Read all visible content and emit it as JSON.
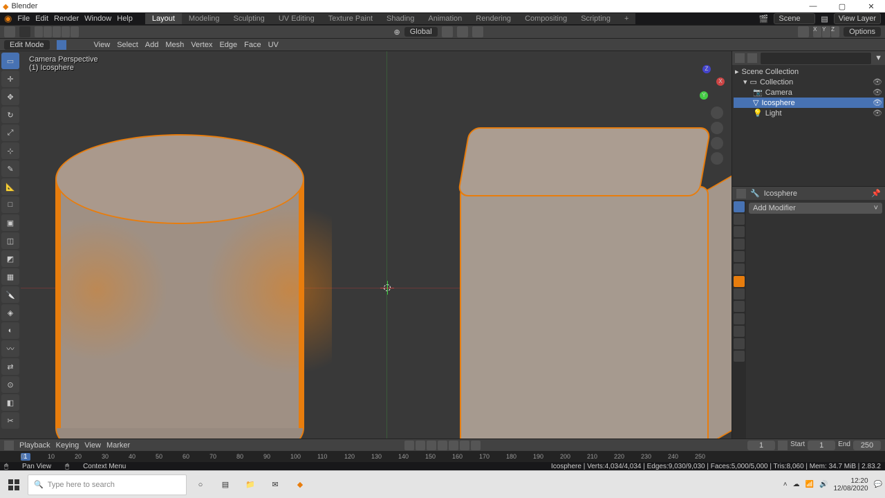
{
  "app": {
    "title": "Blender"
  },
  "window_controls": {
    "min": "—",
    "max": "▢",
    "close": "✕"
  },
  "menus": [
    "File",
    "Edit",
    "Render",
    "Window",
    "Help"
  ],
  "workspaces": [
    "Layout",
    "Modeling",
    "Sculpting",
    "UV Editing",
    "Texture Paint",
    "Shading",
    "Animation",
    "Rendering",
    "Compositing",
    "Scripting"
  ],
  "workspace_active": 0,
  "scene": {
    "label": "Scene",
    "layer": "View Layer"
  },
  "transform_orientation": "Global",
  "options_label": "Options",
  "mode": "Edit Mode",
  "mode_menus": [
    "View",
    "Select",
    "Add",
    "Mesh",
    "Vertex",
    "Edge",
    "Face",
    "UV"
  ],
  "viewport": {
    "persp": "Camera Perspective",
    "obj": "(1) Icosphere"
  },
  "outliner": {
    "root": "Scene Collection",
    "collection": "Collection",
    "items": [
      {
        "name": "Camera",
        "icon": "📷"
      },
      {
        "name": "Icosphere",
        "icon": "▽",
        "selected": true
      },
      {
        "name": "Light",
        "icon": "💡"
      }
    ]
  },
  "properties": {
    "context": "Icosphere",
    "add_modifier": "Add Modifier"
  },
  "timeline": {
    "playback": "Playback",
    "keying": "Keying",
    "view": "View",
    "marker": "Marker",
    "current": "1",
    "start_label": "Start",
    "start": "1",
    "end_label": "End",
    "end": "250",
    "ticks": [
      0,
      10,
      20,
      30,
      40,
      50,
      60,
      70,
      80,
      90,
      100,
      110,
      120,
      130,
      140,
      150,
      160,
      170,
      180,
      190,
      200,
      210,
      220,
      230,
      240,
      250
    ]
  },
  "status": {
    "hint1": "Pan View",
    "hint2": "Context Menu",
    "stats": "Icosphere | Verts:4,034/4,034 | Edges:9,030/9,030 | Faces:5,000/5,000 | Tris:8,060 | Mem: 34.7 MiB | 2.83.2"
  },
  "taskbar": {
    "search_placeholder": "Type here to search",
    "time": "12:20",
    "date": "12/08/2020"
  }
}
